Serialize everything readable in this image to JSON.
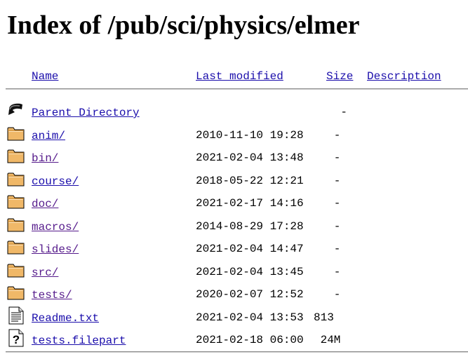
{
  "page": {
    "title": "Index of /pub/sci/physics/elmer"
  },
  "columns": {
    "name": "Name",
    "last_modified": "Last modified",
    "size": "Size",
    "description": "Description"
  },
  "rows": [
    {
      "icon": "back-icon",
      "name": "Parent Directory",
      "date": "",
      "size": "-",
      "visited": false
    },
    {
      "icon": "folder-icon",
      "name": "anim/",
      "date": "2010-11-10 19:28",
      "size": "- ",
      "visited": false
    },
    {
      "icon": "folder-icon",
      "name": "bin/",
      "date": "2021-02-04 13:48",
      "size": "- ",
      "visited": true
    },
    {
      "icon": "folder-icon",
      "name": "course/",
      "date": "2018-05-22 12:21",
      "size": "- ",
      "visited": false
    },
    {
      "icon": "folder-icon",
      "name": "doc/",
      "date": "2021-02-17 14:16",
      "size": "- ",
      "visited": true
    },
    {
      "icon": "folder-icon",
      "name": "macros/",
      "date": "2014-08-29 17:28",
      "size": "- ",
      "visited": true
    },
    {
      "icon": "folder-icon",
      "name": "slides/",
      "date": "2021-02-04 14:47",
      "size": "- ",
      "visited": true
    },
    {
      "icon": "folder-icon",
      "name": "src/",
      "date": "2021-02-04 13:45",
      "size": "- ",
      "visited": true
    },
    {
      "icon": "folder-icon",
      "name": "tests/",
      "date": "2020-02-07 12:52",
      "size": "- ",
      "visited": true
    },
    {
      "icon": "text-file-icon",
      "name": "Readme.txt",
      "date": "2021-02-04 13:53",
      "size": "813  ",
      "visited": false
    },
    {
      "icon": "unknown-file-icon",
      "name": "tests.filepart",
      "date": "2021-02-18 06:00",
      "size": "24M ",
      "visited": false
    }
  ],
  "colors": {
    "link": "#1a0dab",
    "visited_link": "#551a8b",
    "rule": "#8a8a8a",
    "folder_fill": "#f0b868"
  }
}
